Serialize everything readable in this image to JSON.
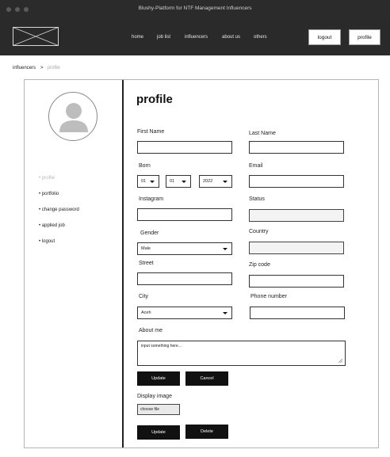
{
  "window": {
    "title": "Blushy-Platform for NTF Management Influencers"
  },
  "nav": {
    "links": [
      "home",
      "job list",
      "influencers",
      "about us",
      "others"
    ],
    "logout_label": "logout",
    "profile_label": "profile"
  },
  "breadcrumb": {
    "root": "influencers",
    "separator": ">",
    "current": "profile"
  },
  "sidebar": {
    "items": [
      "• profile",
      "• portfolio",
      "• change password",
      "• applied job",
      "• logout"
    ]
  },
  "form": {
    "title": "profile",
    "first_name_label": "First Name",
    "last_name_label": "Last Name",
    "born_label": "Born",
    "born_day": "01",
    "born_month": "01",
    "born_year": "2022",
    "email_label": "Email",
    "instagram_label": "Instagram",
    "status_label": "Status",
    "gender_label": "Gender",
    "gender_value": "Male",
    "country_label": "Country",
    "street_label": "Street",
    "zip_label": "Zip code",
    "city_label": "City",
    "city_value": "Aceh",
    "phone_label": "Phone number",
    "about_label": "About me",
    "about_placeholder": "input something here...",
    "update_label": "Update",
    "cancel_label": "Cancel",
    "display_image_label": "Display image",
    "choose_file_label": "choose file",
    "update_image_label": "Update",
    "delete_label": "Delete"
  },
  "colors": {
    "navbar": "#2a2a2a",
    "titlebar": "#2b2b2b",
    "button": "#111111",
    "sidebar_border": "#222222"
  },
  "icons": {
    "logo": "placeholder-logo-icon",
    "avatar": "user-avatar-icon",
    "caret": "caret-down-icon",
    "resize": "resize-handle-icon"
  }
}
